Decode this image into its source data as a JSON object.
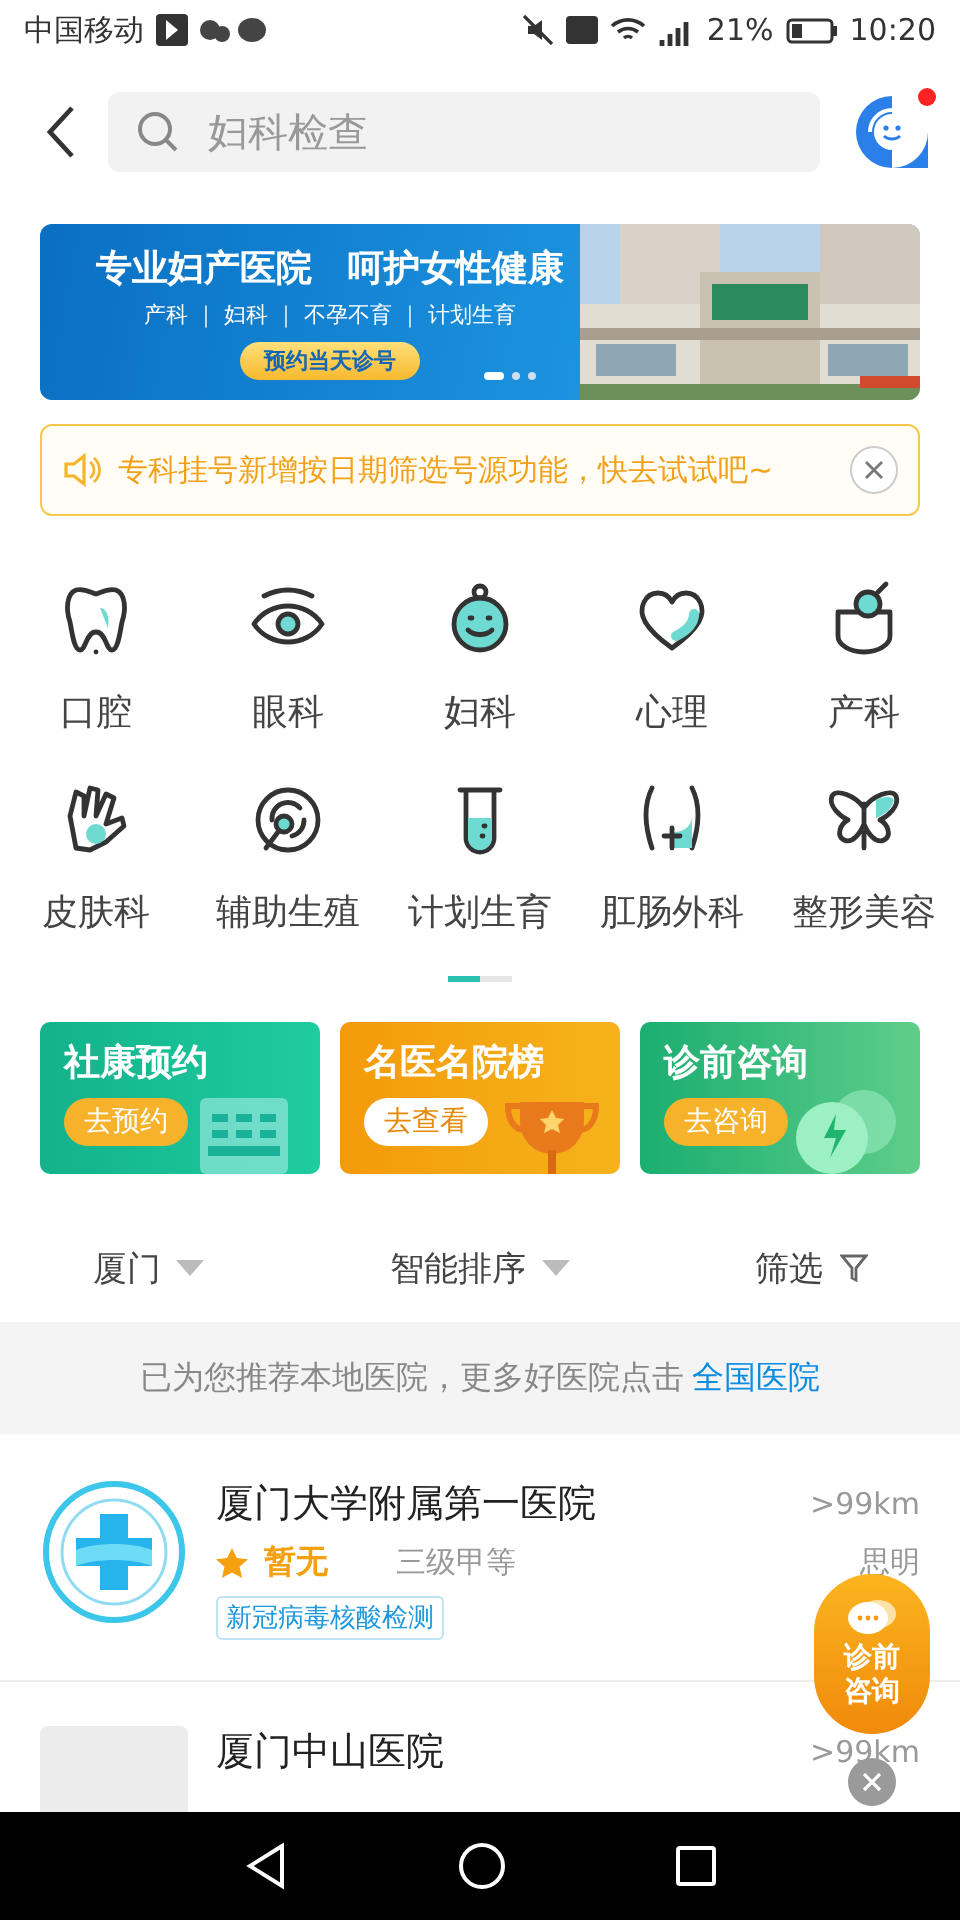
{
  "status_bar": {
    "carrier": "中国移动",
    "battery": "21%",
    "time": "10:20"
  },
  "header": {
    "search": {
      "placeholder": "妇科检查"
    },
    "service_badge": true
  },
  "banner": {
    "title": "专业妇产医院　呵护女性健康",
    "subtitle": "产科 ｜ 妇科 ｜ 不孕不育 ｜ 计划生育",
    "button": "预约当天诊号",
    "dots": [
      {
        "selected": true
      },
      {
        "selected": false
      },
      {
        "selected": false
      }
    ]
  },
  "notice": {
    "text": "专科挂号新增按日期筛选号源功能，快去试试吧~"
  },
  "categories": [
    {
      "label": "口腔"
    },
    {
      "label": "眼科"
    },
    {
      "label": "妇科"
    },
    {
      "label": "心理"
    },
    {
      "label": "产科"
    },
    {
      "label": "皮肤科"
    },
    {
      "label": "辅助生殖"
    },
    {
      "label": "计划生育"
    },
    {
      "label": "肛肠外科"
    },
    {
      "label": "整形美容"
    }
  ],
  "category_pages": [
    {
      "selected": true
    },
    {
      "selected": false
    }
  ],
  "cards": [
    {
      "kind": "appointment",
      "title": "社康预约",
      "button": "去预约"
    },
    {
      "kind": "ranking",
      "title": "名医名院榜",
      "button": "去查看"
    },
    {
      "kind": "consult",
      "title": "诊前咨询",
      "button": "去咨询"
    }
  ],
  "filters": [
    {
      "kind": "dropdown",
      "label": "厦门"
    },
    {
      "kind": "dropdown",
      "label": "智能排序"
    },
    {
      "kind": "filter",
      "label": "筛选"
    }
  ],
  "recommendation": {
    "text": "已为您推荐本地医院，更多好医院点击",
    "link": "全国医院"
  },
  "hospitals": [
    {
      "kind": "emblem",
      "name": "厦门大学附属第一医院",
      "rating": "暂无",
      "grade": "三级甲等",
      "distance": ">99km",
      "district": "思明",
      "tags": [
        "新冠病毒核酸检测"
      ]
    },
    {
      "kind": "placeholder",
      "name": "厦门中山医院",
      "distance": ">99km"
    }
  ],
  "floating_consult": {
    "label": "诊前咨询"
  }
}
